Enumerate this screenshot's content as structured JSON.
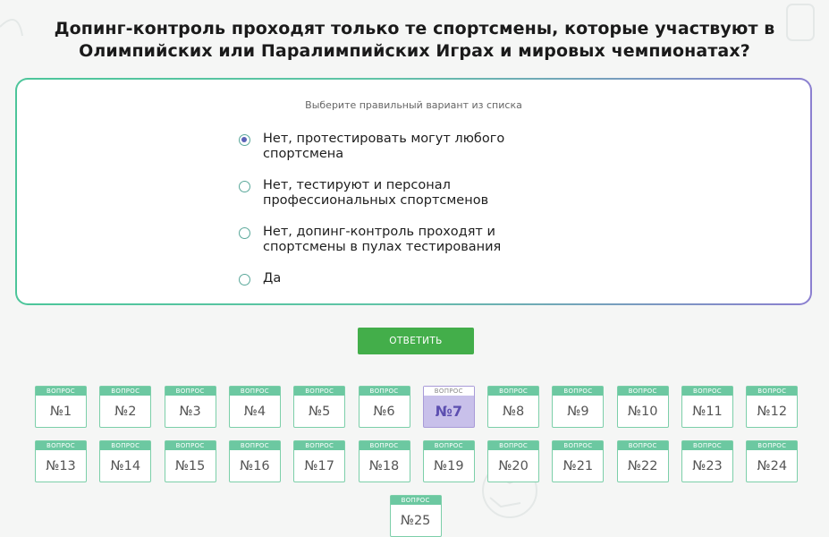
{
  "question": "Допинг-контроль проходят только те спортсмены, которые участвуют в Олимпийских или Паралимпийских Играх и мировых чемпионатах?",
  "hint": "Выберите правильный вариант из списка",
  "options": [
    {
      "label": "Нет, протестировать могут любого спортсмена",
      "selected": true
    },
    {
      "label": "Нет, тестируют и персонал профессиональных спортсменов",
      "selected": false
    },
    {
      "label": "Нет, допинг-контроль проходят и спортсмены в пулах тестирования",
      "selected": false
    },
    {
      "label": "Да",
      "selected": false
    }
  ],
  "submit_label": "ОТВЕТИТЬ",
  "nav": {
    "caption": "ВОПРОС",
    "active": 7,
    "items": [
      "№1",
      "№2",
      "№3",
      "№4",
      "№5",
      "№6",
      "№7",
      "№8",
      "№9",
      "№10",
      "№11",
      "№12",
      "№13",
      "№14",
      "№15",
      "№16",
      "№17",
      "№18",
      "№19",
      "№20",
      "№21",
      "№22",
      "№23",
      "№24",
      "№25"
    ]
  },
  "colors": {
    "accent_green": "#43ae4a",
    "nav_teal": "#6cc8a1",
    "active_purple": "#c8c0ea"
  }
}
